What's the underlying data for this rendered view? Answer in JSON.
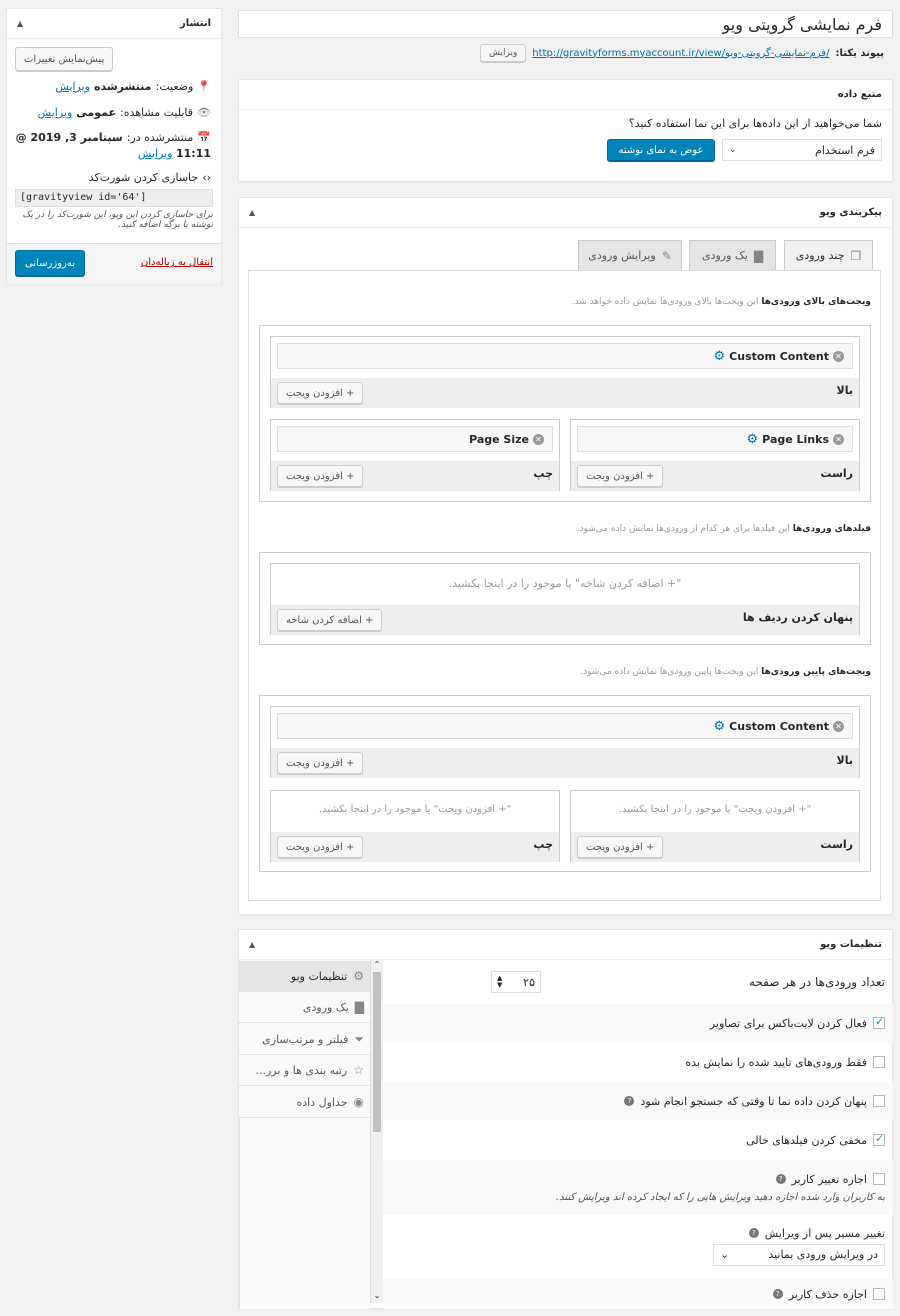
{
  "title_value": "فرم نمایشی گرویتی ویو",
  "permalink": {
    "label": "پیوند یکتا:",
    "url": "http://gravityforms.myaccount.ir/view/فرم-نمایشی-گرویتی-ویو/",
    "edit": "ویرایش"
  },
  "datasource": {
    "title": "منبع داده",
    "question": "شما می‌خواهید از این داده‌ها برای این نما استفاده کنید؟",
    "select": "فرم استخدام",
    "switch_btn": "عوض به نمای نوشته"
  },
  "config": {
    "title": "پیکربندی ویو",
    "tabs": [
      "چند ورودی",
      "یک ورودی",
      "ویرایش ورودی"
    ],
    "above_desc": "این ویجت‌ها بالای ورودی‌ها نمایش داده خواهد شد.",
    "above_bold": "ویجت‌های بالای ورودی‌ها",
    "top_label": "بالا",
    "right_label": "راست",
    "left_label": "چپ",
    "add_widget": "+ افزودن ویجت",
    "custom_content": "Custom Content",
    "page_links": "Page Links",
    "page_size": "Page Size",
    "fields_desc": "این فیلدها برای هر کدام از ورودی‌ها نمایش داده می‌شود.",
    "fields_bold": "فیلدهای ورودی‌ها",
    "fields_placeholder": "\"+ اضافه کردن شاخه\" یا موجود را در اینجا بکشید.",
    "hide_rows": "پنهان کردن ردیف ها",
    "add_field": "+ اضافه کردن شاخه",
    "below_desc": "این ویجت‌ها پایین ورودی‌ها نمایش داده می‌شود.",
    "below_bold": "ویجت‌های پایین ورودی‌ها",
    "widget_placeholder": "\"+ افزودن ویجت\" یا موجود را در اینجا بکشید."
  },
  "publish": {
    "title": "انتشار",
    "preview": "پیش‌نمایش تغییرات",
    "status_label": "وضعیت:",
    "status": "منتشرشده",
    "edit": "ویرایش",
    "visibility_label": "قابلیت مشاهده:",
    "visibility": "عمومی",
    "published_label": "منتشرشده در:",
    "published_date": "سپتامبر 3, 2019 @",
    "published_time": "11:11",
    "embed": "جاسازی کردن شورت‌کد",
    "shortcode": "[gravityview id='64']",
    "embed_help": "برای جاسازی کردن این ویو، این شورت‌کد را در یک نوشته یا برگه اضافه کنید.",
    "trash": "انتقال به زباله‌دان",
    "update": "به‌روزرسانی"
  },
  "settings": {
    "title": "تنظیمات ویو",
    "nav": [
      "تنظیمات ویو",
      "یک ورودی",
      "فیلتر و مرتب‌سازی",
      "رتبه بندی ها و برر...",
      "جداول داده"
    ],
    "page_size_label": "تعداد ورودی‌ها در هر صفحه",
    "page_size_value": "۲۵",
    "lightbox": "فعال کردن لایت‌باکس برای تصاویر",
    "approved": "فقط ورودی‌های تایید شده را نمایش بده",
    "hide_until": "پنهان کردن داده نما تا وقتی که جستجو انجام شود",
    "hide_empty": "مخفی کردن فیلدهای خالی",
    "user_edit": "اجازه تغییر کاربر",
    "user_edit_desc": "به کاربران وارد شده اجازه دهید ویرایش هایی را که ایجاد کرده اند ویرایش کنند.",
    "redirect_label": "تغییر مسیر پس از ویرایش",
    "redirect_value": "در ویرایش ورودی بمانید",
    "user_delete": "اجازه حذف کاربر"
  }
}
